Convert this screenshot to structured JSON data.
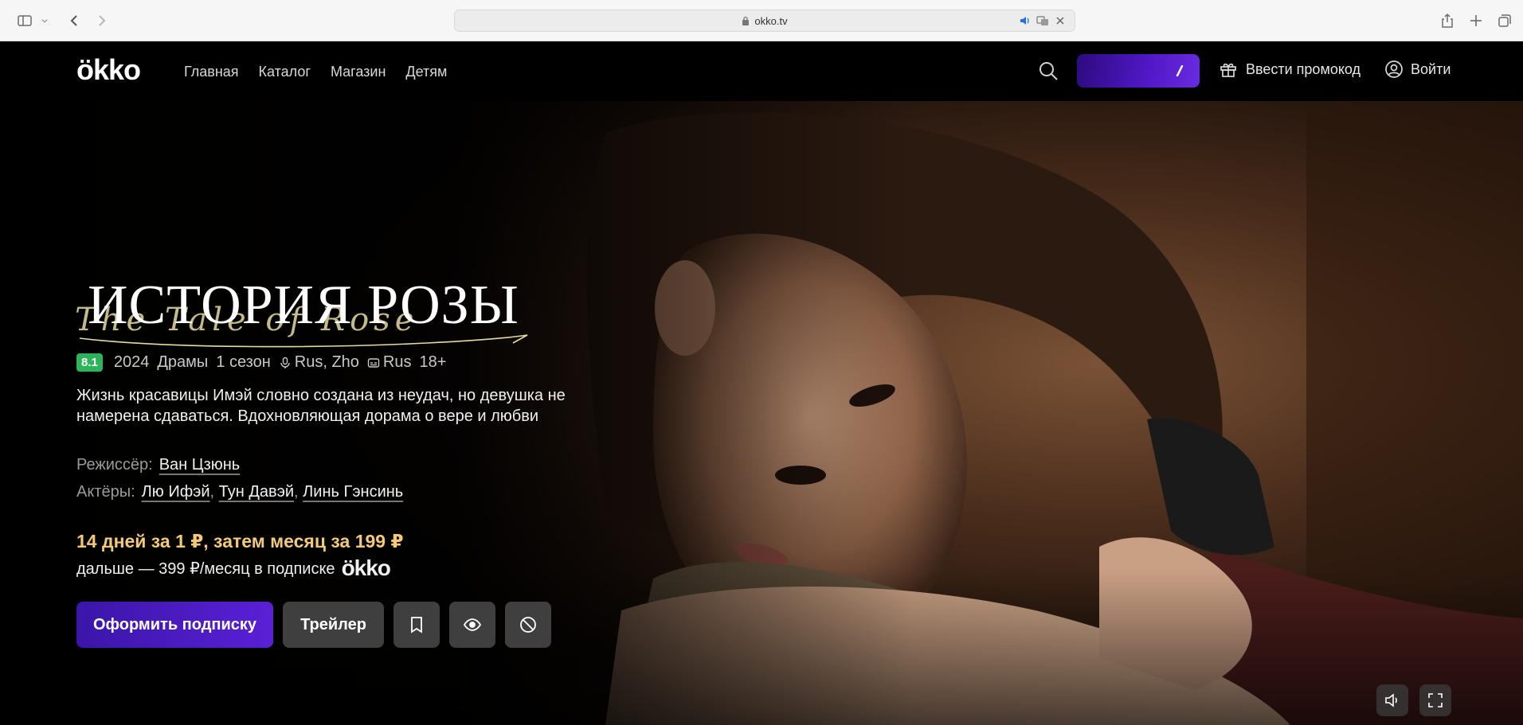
{
  "browser": {
    "url": "okko.tv"
  },
  "header": {
    "logo": "ökko",
    "nav": [
      "Главная",
      "Каталог",
      "Магазин",
      "Детям"
    ],
    "promo_code_label": "Ввести промокод",
    "login_label": "Войти"
  },
  "hero": {
    "title": "ИСТОРИЯ РОЗЫ",
    "title_script": "The Tale of Rose",
    "rating": "8.1",
    "year": "2024",
    "genre": "Драмы",
    "seasons": "1 сезон",
    "audio": "Rus, Zho",
    "subtitles": "Rus",
    "age": "18+",
    "description": "Жизнь красавицы Имэй словно создана из неудач, но девушка не намерена сдаваться. Вдохновляющая дорама о вере и любви",
    "director_label": "Режиссёр:",
    "director": "Ван Цзюнь",
    "actors_label": "Актёры:",
    "actors": [
      "Лю Ифэй",
      "Тун Давэй",
      "Линь Гэнсинь"
    ],
    "offer_main": "14 дней за 1 ₽, затем месяц за 199 ₽",
    "offer_sub": "дальше — 399 ₽/месяц в подписке",
    "offer_logo": "ökko",
    "subscribe_label": "Оформить подписку",
    "trailer_label": "Трейлер"
  },
  "colors": {
    "accent_purple": "#5a20d6",
    "offer_gold": "#f5c97a",
    "rating_green": "#2db35a"
  },
  "icons": {
    "search": "search-icon",
    "gift": "gift-icon",
    "user": "user-icon",
    "bookmark": "bookmark-icon",
    "eye": "eye-icon",
    "block": "block-icon",
    "volume": "volume-icon",
    "fullscreen": "fullscreen-icon"
  }
}
